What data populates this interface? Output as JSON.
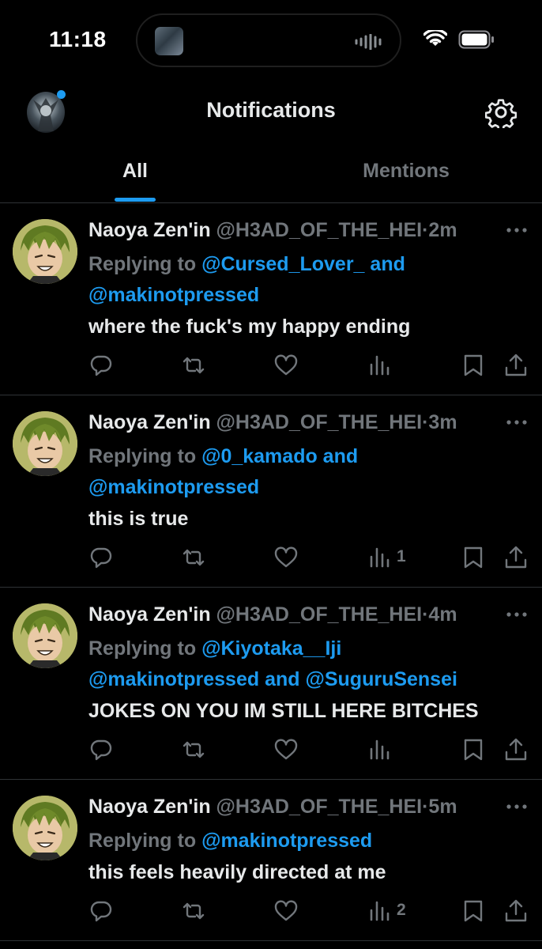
{
  "status_bar": {
    "time": "11:18"
  },
  "header": {
    "title": "Notifications"
  },
  "tabs": [
    {
      "label": "All"
    },
    {
      "label": "Mentions"
    }
  ],
  "colors": {
    "background": "#000000",
    "accent": "#1d9bf0",
    "muted": "#71767b",
    "divider": "#2f3336"
  },
  "notifications": [
    {
      "name": "Naoya Zen'in",
      "handle": "@H3AD_OF_THE_HEI",
      "time": "2m",
      "replying_prefix": "Replying to",
      "replying_to_1": "@Cursed_Lover_",
      "replying_join_1": " and",
      "replying_to_2": "@makinotpressed",
      "replying_join_2": "",
      "replying_to_3": "",
      "text": "where the fuck's my happy ending",
      "views": ""
    },
    {
      "name": "Naoya Zen'in",
      "handle": "@H3AD_OF_THE_HEI",
      "time": "3m",
      "replying_prefix": "Replying to",
      "replying_to_1": "@0_kamado",
      "replying_join_1": " and",
      "replying_to_2": "@makinotpressed",
      "replying_join_2": "",
      "replying_to_3": "",
      "text": "this is true",
      "views": "1"
    },
    {
      "name": "Naoya Zen'in",
      "handle": "@H3AD_OF_THE_HEI",
      "time": "4m",
      "replying_prefix": "Replying to",
      "replying_to_1": "@Kiyotaka__Iji",
      "replying_join_1": "",
      "replying_to_2": "@makinotpressed",
      "replying_join_2": " and ",
      "replying_to_3": "@SuguruSensei",
      "text": "JOKES ON YOU IM STILL HERE BITCHES",
      "views": ""
    },
    {
      "name": "Naoya Zen'in",
      "handle": "@H3AD_OF_THE_HEI",
      "time": "5m",
      "replying_prefix": "Replying to",
      "replying_to_1": "@makinotpressed",
      "replying_join_1": "",
      "replying_to_2": "",
      "replying_join_2": "",
      "replying_to_3": "",
      "text": "this feels heavily directed at me",
      "views": "2"
    }
  ],
  "icons": [
    "wifi-icon",
    "battery-icon",
    "gear-icon",
    "more-icon",
    "reply-icon",
    "repost-icon",
    "like-icon",
    "views-icon",
    "bookmark-icon",
    "share-icon"
  ]
}
